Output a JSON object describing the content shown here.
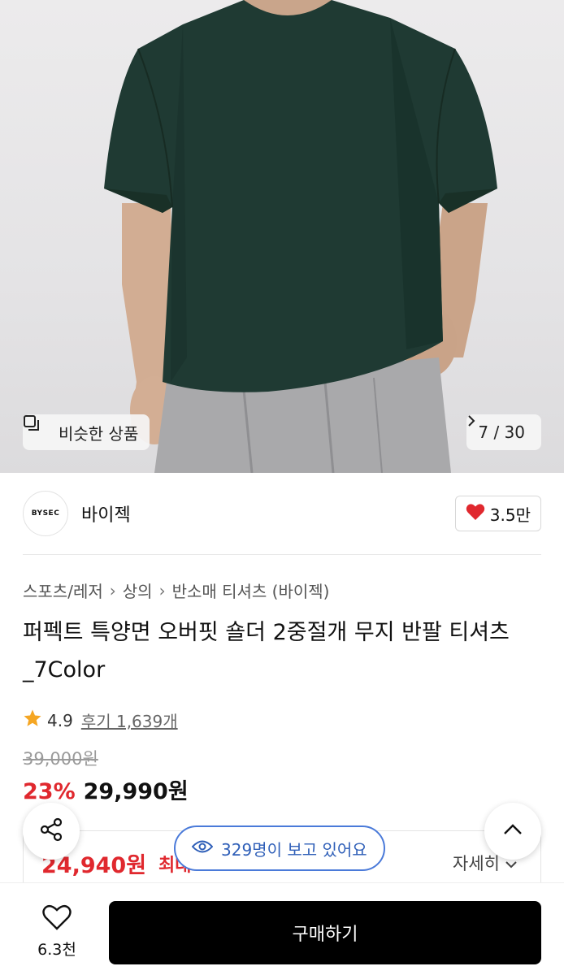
{
  "hero": {
    "similar_label": "비슷한 상품",
    "counter": "7 / 30",
    "icons": {
      "similar": "similar-items-icon",
      "next": "chevron-right-icon"
    }
  },
  "brand": {
    "logo_text": "BYSEC",
    "name": "바이젝",
    "likes": "3.5만",
    "like_color": "#e0282e"
  },
  "breadcrumb": [
    "스포츠/레저",
    "상의",
    "반소매 티셔츠 (바이젝)"
  ],
  "product": {
    "title": "퍼펙트 특양면 오버핏 숄더 2중절개 무지 반팔 티셔츠_7Color",
    "rating": "4.9",
    "reviews": "후기 1,639개",
    "original_price": "39,000원",
    "discount": "23%",
    "price": "29,990원"
  },
  "benefit": {
    "price": "24,940원",
    "label": "최대",
    "more": "자세히"
  },
  "viewers": {
    "text": "329명이 보고 있어요"
  },
  "bottom": {
    "wish_count": "6.3천",
    "buy_label": "구매하기"
  },
  "colors": {
    "accent_red": "#e0282e",
    "viewer_blue": "#2f5fb8",
    "star": "#f5a623",
    "shirt": "#1f3a33"
  }
}
